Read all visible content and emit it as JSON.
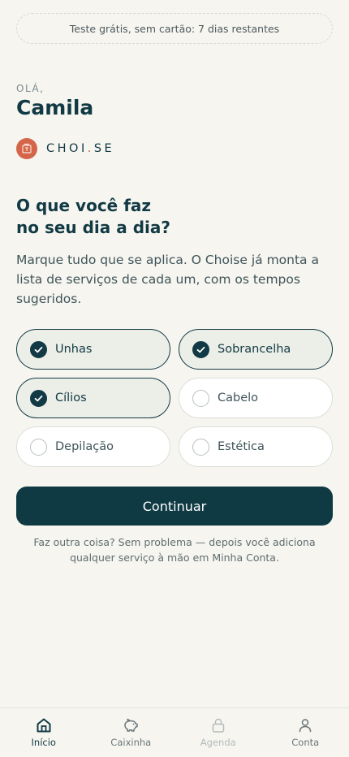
{
  "trial_banner": "Teste grátis, sem cartão: 7 dias restantes",
  "greeting": {
    "label": "OLÁ,",
    "name": "Camila"
  },
  "brand": {
    "name_part1": "CHOI",
    "dot": ".",
    "name_part2": "SE",
    "logo_color": "#d4654a"
  },
  "question": {
    "line1": "O que você faz",
    "line2": "no seu dia a dia?"
  },
  "description": "Marque tudo que se aplica. O Choise já monta a lista de serviços de cada um, com os tempos sugeridos.",
  "options": [
    {
      "label": "Unhas",
      "selected": true
    },
    {
      "label": "Sobrancelha",
      "selected": true
    },
    {
      "label": "Cílios",
      "selected": true
    },
    {
      "label": "Cabelo",
      "selected": false
    },
    {
      "label": "Depilação",
      "selected": false
    },
    {
      "label": "Estética",
      "selected": false
    }
  ],
  "continue_label": "Continuar",
  "footnote": {
    "line1": "Faz outra coisa? Sem problema — depois você adiciona",
    "line2": "qualquer serviço à mão em Minha Conta."
  },
  "tabs": [
    {
      "label": "Início",
      "icon": "home-icon",
      "state": "active"
    },
    {
      "label": "Caixinha",
      "icon": "piggy-bank-icon",
      "state": "normal"
    },
    {
      "label": "Agenda",
      "icon": "lock-icon",
      "state": "disabled"
    },
    {
      "label": "Conta",
      "icon": "user-icon",
      "state": "normal"
    }
  ],
  "colors": {
    "primary": "#0f3a44",
    "accent": "#d4654a",
    "background": "#f6f5f0"
  }
}
